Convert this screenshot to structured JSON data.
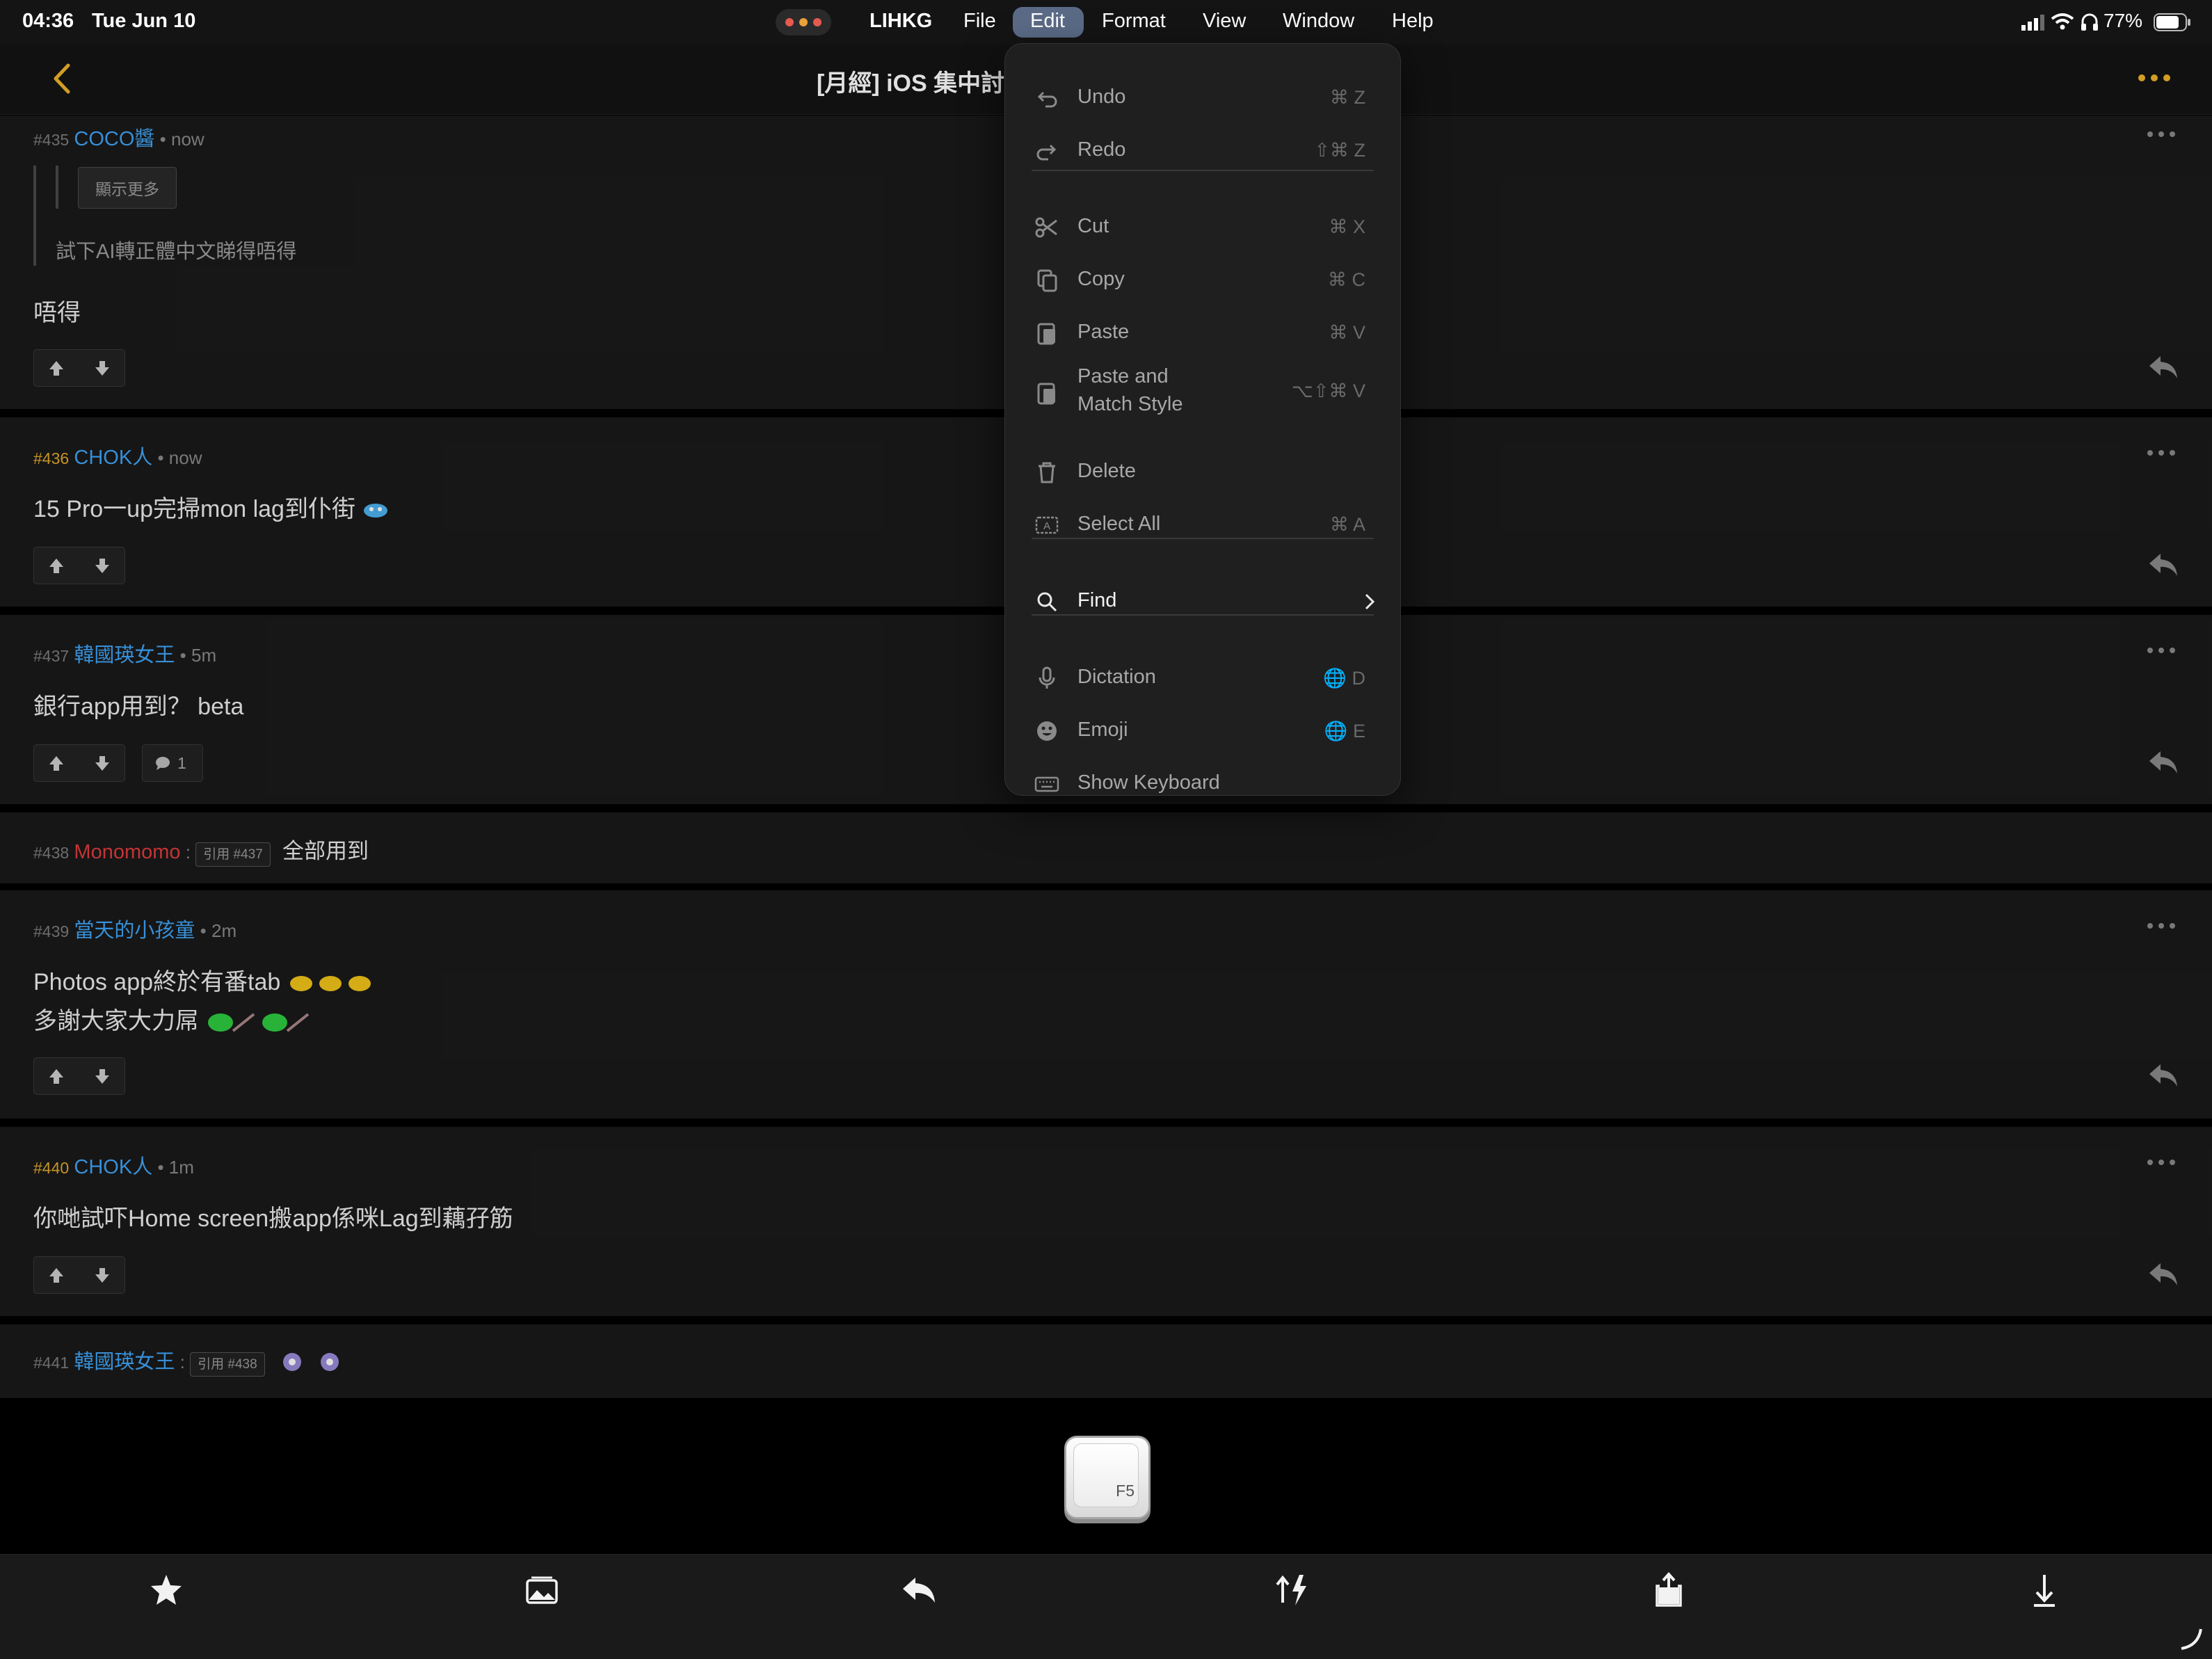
{
  "status_bar": {
    "time": "04:36",
    "date": "Tue Jun 10",
    "battery": "77%"
  },
  "menu_bar": {
    "app_name": "LIHKG",
    "items": [
      "File",
      "Edit",
      "Format",
      "View",
      "Window",
      "Help"
    ],
    "active": "Edit"
  },
  "header": {
    "title": "[月經] iOS 集中討論"
  },
  "posts": [
    {
      "number": "#435",
      "user": "COCO醬",
      "time": "now",
      "quote": {
        "show_more": "顯示更多",
        "text": "試下AI轉正體中文睇得唔得"
      },
      "lines": [
        "唔得"
      ]
    },
    {
      "number": "#436",
      "user": "CHOK人",
      "time": "now",
      "lines": [
        "15 Pro一up完掃mon lag到仆街"
      ]
    },
    {
      "number": "#437",
      "user": "韓國瑛女王",
      "time": "5m",
      "lines": [
        "銀行app用到？ beta"
      ],
      "comment_count": "1"
    },
    {
      "number": "#438",
      "user": "Monomomo",
      "quote_tag": "引用 #437",
      "inline_text": "全部用到"
    },
    {
      "number": "#439",
      "user": "當天的小孩童",
      "time": "2m",
      "lines": [
        "Photos app終於有番tab",
        "多謝大家大力屌"
      ]
    },
    {
      "number": "#440",
      "user": "CHOK人",
      "time": "1m",
      "lines": [
        "你哋試吓Home screen搬app係咪Lag到藕孖筋"
      ]
    },
    {
      "number": "#441",
      "user": "韓國瑛女王",
      "quote_tag": "引用 #438"
    }
  ],
  "edit_menu": {
    "items": [
      {
        "label": "Undo",
        "shortcut": "⌘ Z",
        "icon": "undo-icon"
      },
      {
        "label": "Redo",
        "shortcut": "⇧⌘ Z",
        "icon": "redo-icon"
      },
      {
        "label": "Cut",
        "shortcut": "⌘ X",
        "icon": "scissors-icon"
      },
      {
        "label": "Copy",
        "shortcut": "⌘ C",
        "icon": "copy-icon"
      },
      {
        "label": "Paste",
        "shortcut": "⌘ V",
        "icon": "paste-icon"
      },
      {
        "label": "Paste and",
        "label2": "Match Style",
        "shortcut": "⌥⇧⌘ V",
        "icon": "paste-match-icon"
      },
      {
        "label": "Delete",
        "icon": "trash-icon"
      },
      {
        "label": "Select All",
        "shortcut": "⌘ A",
        "icon": "select-all-icon"
      },
      {
        "label": "Find",
        "icon": "search-icon"
      },
      {
        "label": "Dictation",
        "shortcut": "🌐 D",
        "icon": "microphone-icon"
      },
      {
        "label": "Emoji",
        "shortcut": "🌐 E",
        "icon": "emoji-icon"
      },
      {
        "label": "Show Keyboard",
        "icon": "keyboard-icon"
      }
    ]
  },
  "key_overlay": {
    "label": "F5"
  }
}
